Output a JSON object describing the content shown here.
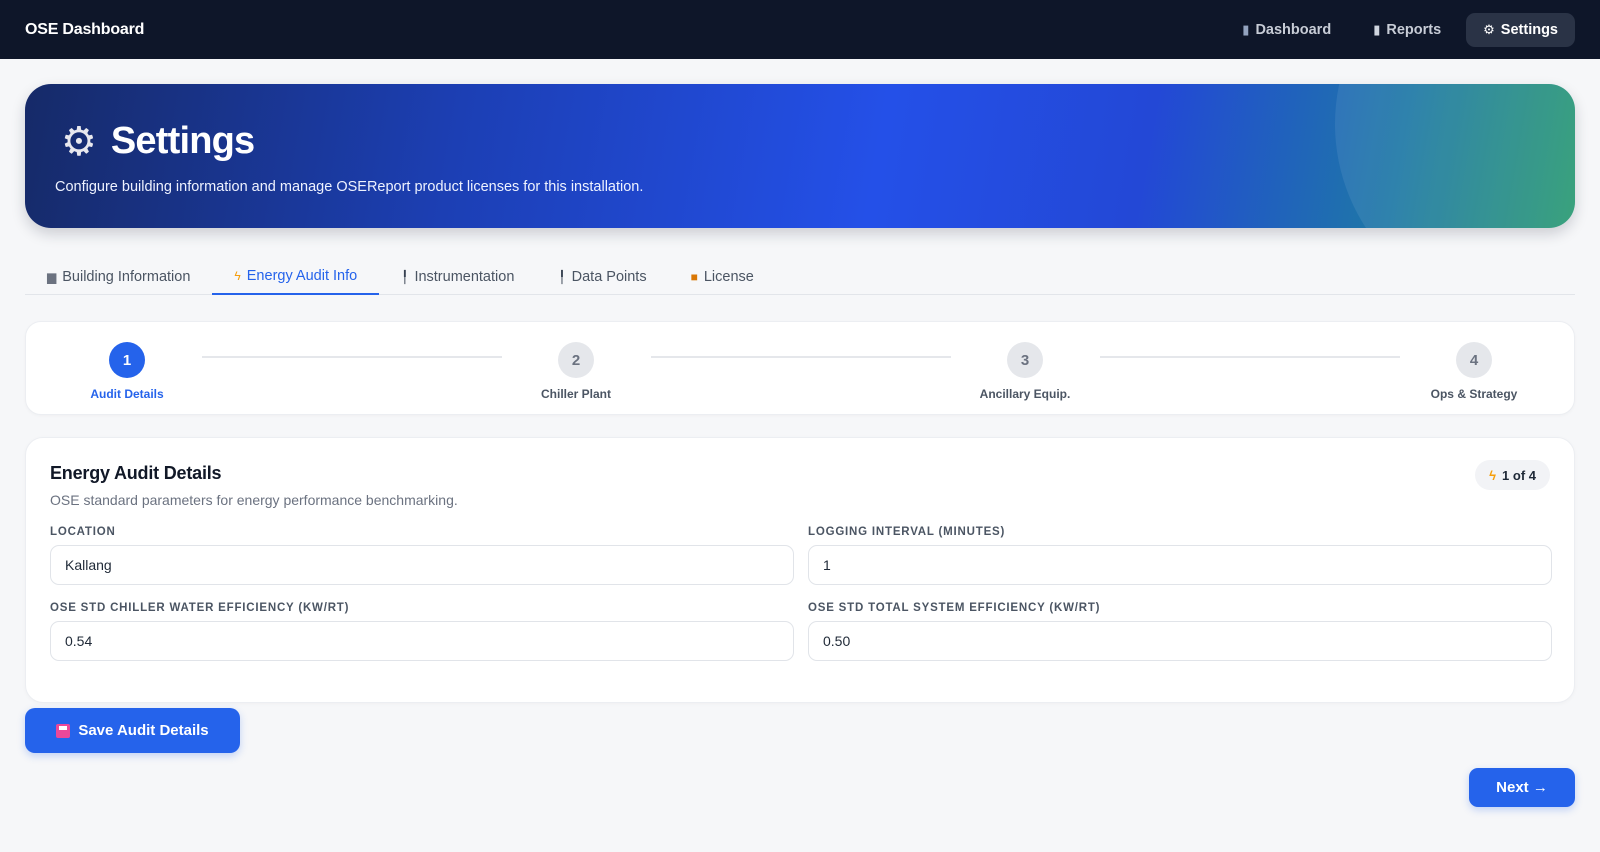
{
  "app": {
    "brand": "OSE Dashboard"
  },
  "nav": [
    {
      "label": "Dashboard",
      "icon": "chart-icon",
      "glyph": "▮"
    },
    {
      "label": "Reports",
      "icon": "document-icon",
      "glyph": "▯"
    },
    {
      "label": "Settings",
      "icon": "gear-icon",
      "glyph": "⚙",
      "active": true
    }
  ],
  "hero": {
    "title": "Settings",
    "subtitle": "Configure building information and manage OSEReport product licenses for this installation."
  },
  "tabs": [
    {
      "label": "Building Information",
      "icon": "building-icon"
    },
    {
      "label": "Energy Audit Info",
      "icon": "lightning-icon",
      "active": true
    },
    {
      "label": "Instrumentation",
      "icon": "pin-icon"
    },
    {
      "label": "Data Points",
      "icon": "pin-icon"
    },
    {
      "label": "License",
      "icon": "lock-icon"
    }
  ],
  "steps": [
    {
      "num": "1",
      "label": "Audit Details",
      "active": true
    },
    {
      "num": "2",
      "label": "Chiller Plant"
    },
    {
      "num": "3",
      "label": "Ancillary Equip."
    },
    {
      "num": "4",
      "label": "Ops & Strategy"
    }
  ],
  "card": {
    "title": "Energy Audit Details",
    "description": "OSE standard parameters for energy performance benchmarking.",
    "pill": "1 of 4",
    "fields": {
      "location": {
        "label": "LOCATION",
        "value": "Kallang"
      },
      "logging_interval": {
        "label": "LOGGING INTERVAL (MINUTES)",
        "value": "1"
      },
      "chiller_eff": {
        "label": "OSE STD CHILLER WATER EFFICIENCY (KW/RT)",
        "value": "0.54"
      },
      "system_eff": {
        "label": "OSE STD TOTAL SYSTEM EFFICIENCY (KW/RT)",
        "value": "0.50"
      }
    }
  },
  "actions": {
    "save": "Save Audit Details",
    "next": "Next →"
  },
  "colors": {
    "primary": "#2563eb",
    "nav_bg": "#0e1629",
    "accent_bolt": "#f59e0b"
  }
}
